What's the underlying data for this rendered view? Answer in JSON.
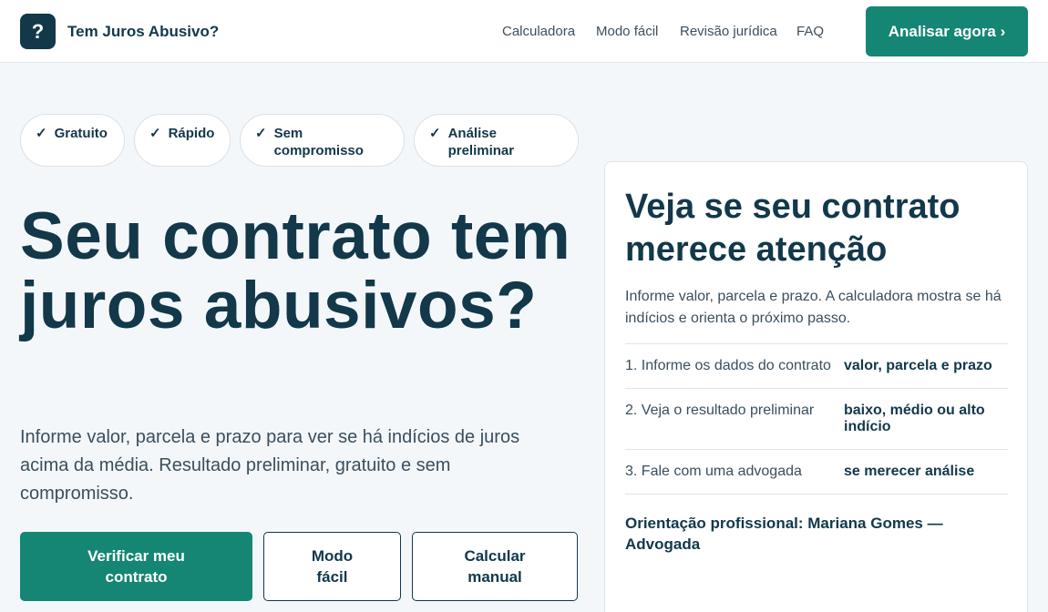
{
  "header": {
    "logo_glyph": "?",
    "brand": "Tem Juros Abusivo?",
    "nav": [
      "Calculadora",
      "Modo fácil",
      "Revisão jurídica",
      "FAQ"
    ],
    "cta": "Analisar agora ›"
  },
  "pills": [
    {
      "check": "✓",
      "label": "Gratuito"
    },
    {
      "check": "✓",
      "label": "Rápido"
    },
    {
      "check": "✓",
      "label": "Sem compromisso"
    },
    {
      "check": "✓",
      "label": "Análise preliminar"
    }
  ],
  "hero": {
    "title": "Seu contrato tem juros abusivos?",
    "subtitle": "Informe valor, parcela e prazo para ver se há indícios de juros acima da média. Resultado preliminar, gratuito e sem compromisso.",
    "buttons": {
      "primary": "Verificar meu contrato",
      "easy": "Modo fácil",
      "manual": "Calcular manual"
    }
  },
  "card": {
    "title": "Veja se seu contrato merece atenção",
    "description": "Informe valor, parcela e prazo. A calculadora mostra se há indícios e orienta o próximo passo.",
    "steps": [
      {
        "label": "1. Informe os dados do contrato",
        "value": "valor, parcela e prazo"
      },
      {
        "label": "2. Veja o resultado preliminar",
        "value": "baixo, médio ou alto indício"
      },
      {
        "label": "3. Fale com uma advogada",
        "value": "se merecer análise"
      }
    ],
    "footer": "Orientação profissional: Mariana Gomes — Advogada"
  },
  "colors": {
    "primary": "#158674",
    "navy": "#12384a",
    "background": "#f4f7fa"
  }
}
